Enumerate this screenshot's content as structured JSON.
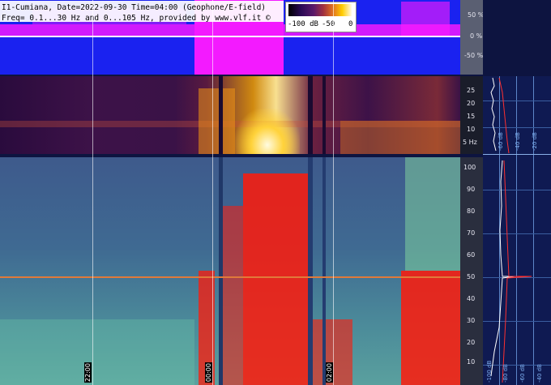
{
  "header": {
    "line1": "I1-Cumiana, Date=2022-09-30 Time=04:00 (Geophone/E-field)",
    "line2": "Freq= 0.1...30 Hz and 0...105 Hz, provided by www.vlf.it ©"
  },
  "color_scale": {
    "labels": [
      "-100 dB",
      "-50",
      "0"
    ]
  },
  "top_axis": {
    "ticks": [
      "50 %",
      "0 %",
      "-50 %"
    ]
  },
  "mid_axis": {
    "ticks": [
      "25",
      "20",
      "15",
      "10",
      "5 Hz"
    ]
  },
  "low_axis": {
    "ticks": [
      "100",
      "90",
      "80",
      "70",
      "60",
      "50",
      "40",
      "30",
      "20",
      "10"
    ]
  },
  "right_graph": {
    "top_labels": [
      "-60 dB",
      "-40 dB",
      "-20 dB"
    ],
    "bottom_labels": [
      "-100 dB",
      "-80 dB",
      "-60 dB",
      "-40 dB"
    ]
  },
  "time_labels": [
    "22:00",
    "00:00",
    "02:00"
  ],
  "colors": {
    "top_bg": "#1a22f0",
    "magenta": "#ff1aff",
    "red_signal": "#ff1a0a",
    "mains_line": "#e07a3a"
  }
}
